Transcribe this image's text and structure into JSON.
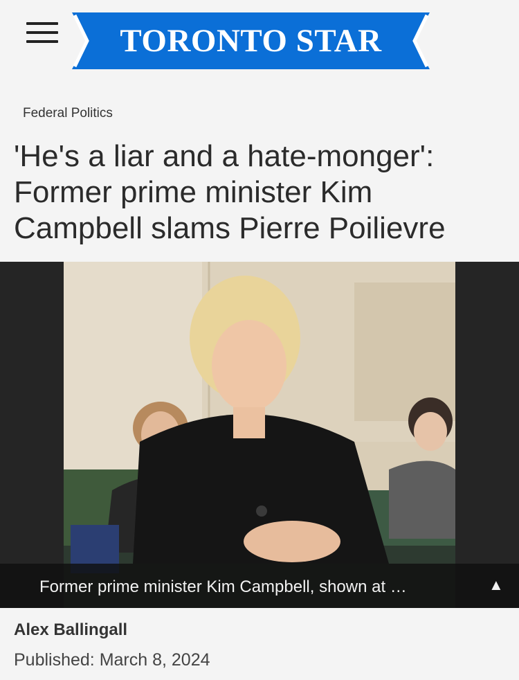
{
  "header": {
    "menu_icon": "hamburger-menu-icon",
    "logo_text": "TORONTO STAR",
    "brand_color": "#0b6fd7"
  },
  "article": {
    "section": "Federal Politics",
    "headline": "'He's a liar and a hate-monger': Former prime minister Kim Campbell slams Pierre Poilievre",
    "photo": {
      "caption": "Former prime minister Kim Campbell, shown at …",
      "caption_toggle_icon": "triangle-up-icon"
    },
    "author": "Alex Ballingall",
    "published": "Published: March 8, 2024"
  }
}
